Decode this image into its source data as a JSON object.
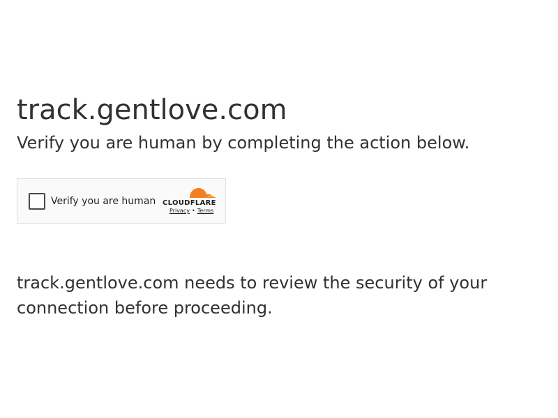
{
  "header": {
    "site_title": "track.gentlove.com",
    "subtitle": "Verify you are human by completing the action below."
  },
  "challenge_widget": {
    "checkbox_label": "Verify you are human",
    "brand_name": "CLOUDFLARE",
    "brand_icon": "cloudflare-cloud-icon",
    "privacy_link": "Privacy",
    "separator": "•",
    "terms_link": "Terms",
    "brand_color": "#f38020"
  },
  "main": {
    "security_message": "track.gentlove.com needs to review the security of your connection before proceeding."
  }
}
